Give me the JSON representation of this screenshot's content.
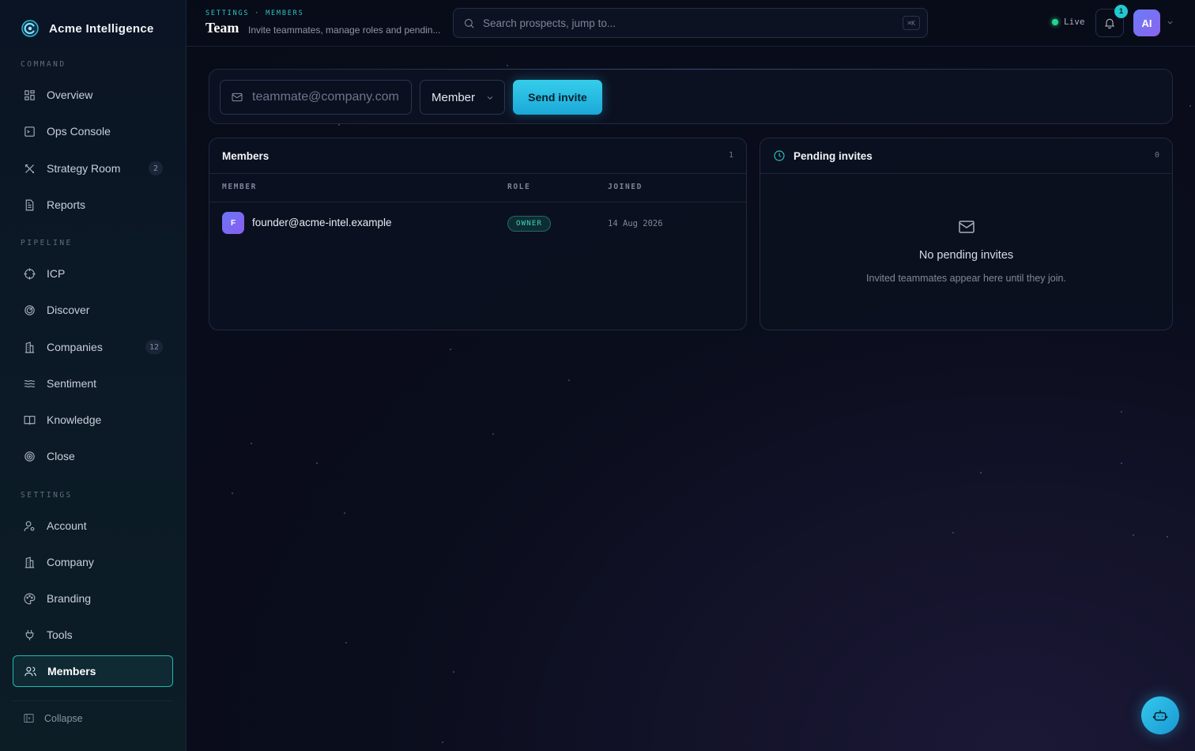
{
  "app": {
    "name": "Acme Intelligence"
  },
  "sidebar": {
    "sections": [
      {
        "label": "COMMAND",
        "items": [
          {
            "label": "Overview",
            "icon": "grid-icon"
          },
          {
            "label": "Ops Console",
            "icon": "terminal-icon"
          },
          {
            "label": "Strategy Room",
            "icon": "tools-cross-icon",
            "badge": "2"
          },
          {
            "label": "Reports",
            "icon": "file-icon"
          }
        ]
      },
      {
        "label": "PIPELINE",
        "items": [
          {
            "label": "ICP",
            "icon": "crosshair-icon"
          },
          {
            "label": "Discover",
            "icon": "radar-icon"
          },
          {
            "label": "Companies",
            "icon": "building-icon",
            "badge": "12"
          },
          {
            "label": "Sentiment",
            "icon": "waves-icon"
          },
          {
            "label": "Knowledge",
            "icon": "book-icon"
          },
          {
            "label": "Close",
            "icon": "target-icon"
          }
        ]
      },
      {
        "label": "SETTINGS",
        "items": [
          {
            "label": "Account",
            "icon": "user-cog-icon"
          },
          {
            "label": "Company",
            "icon": "building-icon"
          },
          {
            "label": "Branding",
            "icon": "palette-icon"
          },
          {
            "label": "Tools",
            "icon": "plug-icon"
          },
          {
            "label": "Members",
            "icon": "users-icon",
            "active": true
          }
        ]
      }
    ],
    "collapse_label": "Collapse"
  },
  "header": {
    "breadcrumb": "SETTINGS · MEMBERS",
    "title": "Team",
    "subtitle": "Invite teammates, manage roles and pendin...",
    "search_placeholder": "Search prospects, jump to...",
    "search_shortcut": "⌘K",
    "live_label": "Live",
    "notification_count": "1",
    "avatar_initials": "AI"
  },
  "invite": {
    "email_placeholder": "teammate@company.com",
    "role_value": "Member",
    "send_label": "Send invite"
  },
  "members": {
    "title": "Members",
    "count": "1",
    "columns": [
      "MEMBER",
      "ROLE",
      "JOINED"
    ],
    "rows": [
      {
        "initial": "F",
        "email": "founder@acme-intel.example",
        "role": "OWNER",
        "joined": "14 Aug 2026"
      }
    ]
  },
  "pending": {
    "title": "Pending invites",
    "count": "0",
    "empty_title": "No pending invites",
    "empty_subtitle": "Invited teammates appear here until they join."
  },
  "colors": {
    "accent": "#22c9cf",
    "live": "#27d38c",
    "avatar": "#7a6ff3"
  }
}
